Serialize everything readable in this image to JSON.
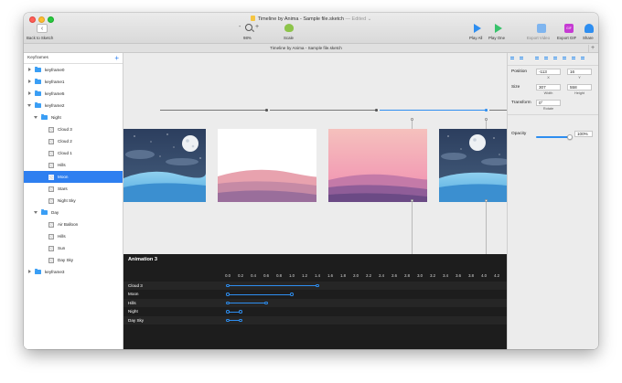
{
  "window": {
    "title": "Timeline by Anima - Sample file.sketch",
    "edited": "— Edited ⌄"
  },
  "toolbar": {
    "back_label": "Back to Sketch",
    "zoom_value": "98%",
    "scale_label": "Scale",
    "play_all_label": "Play All",
    "play_one_label": "Play One",
    "export_video_label": "Export Video",
    "export_gif_label": "Export GIF",
    "share_label": "Share",
    "gif_badge": "GIF",
    "zoom_minus": "-",
    "zoom_plus": "+"
  },
  "tab": {
    "label": "Timeline by Anima - Sample file.sketch",
    "add": "+"
  },
  "sidebar": {
    "title": "Keyframes",
    "add": "+",
    "rows": [
      {
        "label": "keyframe0"
      },
      {
        "label": "keyframe1"
      },
      {
        "label": "keyframe5"
      },
      {
        "label": "keyframe2"
      },
      {
        "label": "Night"
      },
      {
        "label": "Cloud 3"
      },
      {
        "label": "Cloud 2"
      },
      {
        "label": "Cloud 1"
      },
      {
        "label": "Hills"
      },
      {
        "label": "Moon"
      },
      {
        "label": "Stars"
      },
      {
        "label": "Night Sky"
      },
      {
        "label": "Day"
      },
      {
        "label": "Air Balloon"
      },
      {
        "label": "Hills"
      },
      {
        "label": "Sun"
      },
      {
        "label": "Day Sky"
      },
      {
        "label": "keyframe3"
      }
    ]
  },
  "animation": {
    "title": "Animation 3",
    "ticks": [
      "0.0",
      "0.2",
      "0.4",
      "0.6",
      "0.8",
      "1.0",
      "1.2",
      "1.4",
      "1.6",
      "1.8",
      "2.0",
      "2.2",
      "2.4",
      "2.6",
      "2.8",
      "3.0",
      "3.2",
      "3.4",
      "3.6",
      "3.8",
      "4.0",
      "4.2"
    ],
    "tracks": [
      {
        "label": "Cloud 3",
        "start": 0.0,
        "end": 1.4
      },
      {
        "label": "Moon",
        "start": 0.0,
        "end": 1.0
      },
      {
        "label": "Hills",
        "start": 0.0,
        "end": 0.6
      },
      {
        "label": "Night",
        "start": 0.0,
        "end": 0.2
      },
      {
        "label": "Day Sky",
        "start": 0.0,
        "end": 0.2
      }
    ]
  },
  "inspector": {
    "position_label": "Position",
    "x_value": "-113",
    "y_value": "16",
    "x_sub": "X",
    "y_sub": "Y",
    "size_label": "Size",
    "width_value": "307",
    "height_value": "558",
    "width_sub": "Width",
    "height_sub": "Height",
    "transform_label": "Transform",
    "rotate_value": "0°",
    "rotate_sub": "Rotate",
    "opacity_label": "Opacity",
    "opacity_value": "100%",
    "opacity_level": 1.0
  },
  "colors": {
    "accent": "#2e7ff0",
    "panel_dark": "#1d1d1d"
  }
}
